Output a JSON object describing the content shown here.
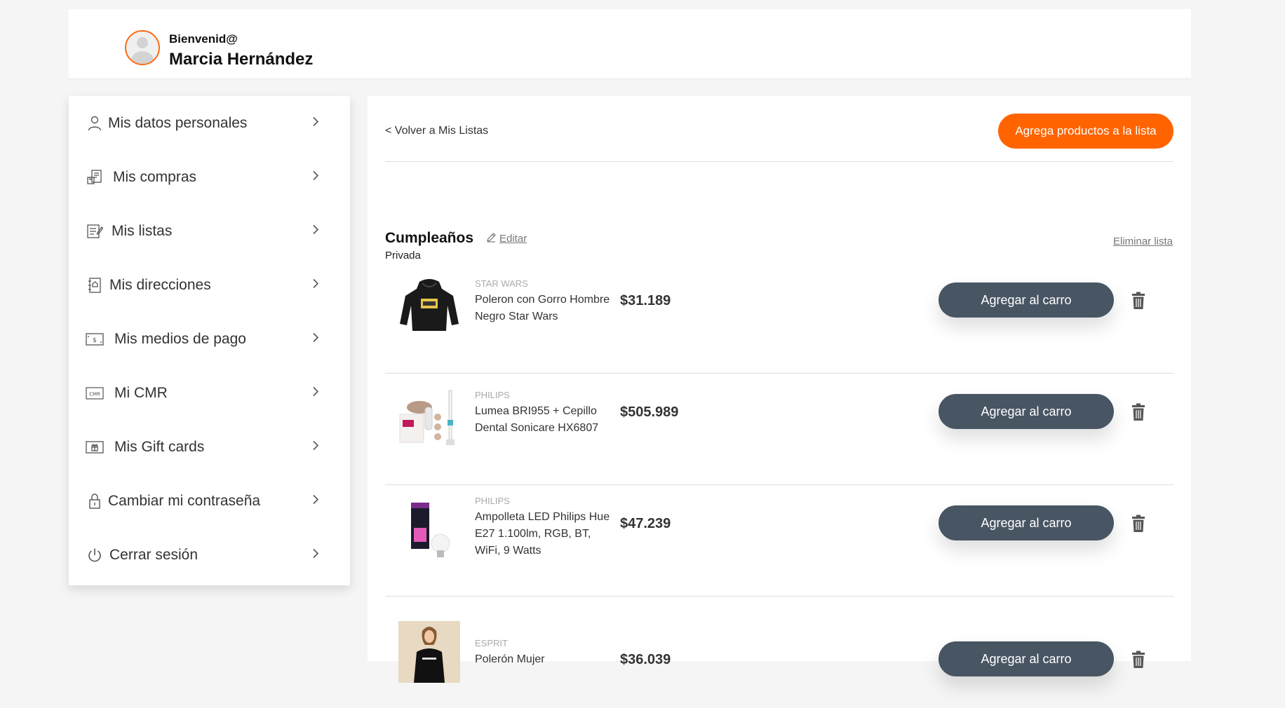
{
  "header": {
    "greeting": "Bienvenid@",
    "user_name": "Marcia Hernández"
  },
  "sidebar": {
    "items": [
      {
        "label": "Mis datos personales",
        "icon": "user-icon"
      },
      {
        "label": "Mis compras",
        "icon": "purchases-icon"
      },
      {
        "label": "Mis listas",
        "icon": "list-icon"
      },
      {
        "label": "Mis direcciones",
        "icon": "address-book-icon"
      },
      {
        "label": "Mis medios de pago",
        "icon": "payment-icon"
      },
      {
        "label": "Mi CMR",
        "icon": "cmr-card-icon"
      },
      {
        "label": "Mis Gift cards",
        "icon": "gift-card-icon"
      },
      {
        "label": "Cambiar mi contraseña",
        "icon": "lock-icon"
      },
      {
        "label": "Cerrar sesión",
        "icon": "power-icon"
      }
    ]
  },
  "main": {
    "back_label": "< Volver a Mis Listas",
    "add_products_label": "Agrega productos a la lista",
    "list": {
      "name": "Cumpleaños",
      "edit_label": "Editar",
      "privacy": "Privada",
      "delete_label": "Eliminar lista"
    },
    "products": [
      {
        "brand": "STAR WARS",
        "name": "Poleron con Gorro Hombre Negro Star Wars",
        "price": "$31.189",
        "cart_label": "Agregar al carro"
      },
      {
        "brand": "PHILIPS",
        "name": "Lumea BRI955 + Cepillo Dental Sonicare HX6807",
        "price": "$505.989",
        "cart_label": "Agregar al carro"
      },
      {
        "brand": "PHILIPS",
        "name": "Ampolleta LED Philips Hue E27 1.100lm, RGB, BT, WiFi, 9 Watts",
        "price": "$47.239",
        "cart_label": "Agregar al carro"
      },
      {
        "brand": "ESPRIT",
        "name": "Polerón Mujer",
        "price": "$36.039",
        "cart_label": "Agregar al carro"
      }
    ]
  },
  "colors": {
    "accent": "#ff6400",
    "cart_button": "#485563",
    "avatar_ring": "#ff6a13"
  }
}
